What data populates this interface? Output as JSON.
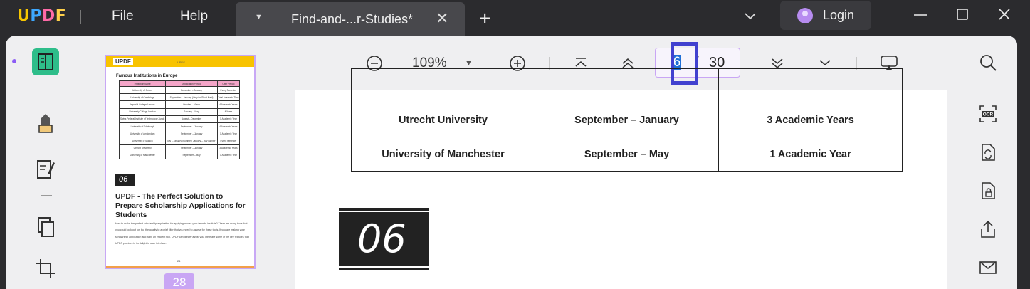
{
  "app": {
    "logo": {
      "u": "U",
      "p": "P",
      "d": "D",
      "f": "F"
    },
    "menu": {
      "file": "File",
      "help": "Help"
    },
    "tab": {
      "title": "Find-and-...r-Studies*"
    },
    "login": {
      "label": "Login"
    }
  },
  "toolbar": {
    "zoom": "109%",
    "page_current": "6",
    "page_separator": "/",
    "page_total": "30"
  },
  "thumbnail": {
    "page_label": "28",
    "logo": "UPDF",
    "header_mid": "UPDF",
    "title": "Famous Institutions in Europe",
    "table_header": [
      "Institution Name",
      "Application Period",
      "Offer Period"
    ],
    "table_rows": [
      [
        "University of Oxford",
        "December – January",
        "Every Semester"
      ],
      [
        "University of Cambridge",
        "September – January (Only for Short-lived)",
        "Total Academic Time"
      ],
      [
        "Imperial College London",
        "October – March",
        "4 Academic Years"
      ],
      [
        "University College London",
        "January – May",
        "4 Years"
      ],
      [
        "Swiss Federal Institute of Technology Zurich",
        "August – December",
        "1 Academic Year"
      ],
      [
        "University of Edinburgh",
        "September – January",
        "4 Academic Years"
      ],
      [
        "University of Amsterdam",
        "September – January",
        "1 Academic Year"
      ],
      [
        "University of Munich",
        "July – January (Summer) January – July (Winter)",
        "Every Semester"
      ],
      [
        "Utrecht University",
        "September – January",
        "3 Academic Years"
      ],
      [
        "University of Manchester",
        "September – May",
        "1 Academic Year"
      ]
    ],
    "chapter_num": "06",
    "heading": "UPDF - The Perfect Solution to Prepare Scholarship Applications for Students",
    "paragraph": "How to make the perfect scholarship application for applying across your favorite institute? There are many tools that you could look out for, but the quality to a chief filter that you need to assess for these tools. If you are making your scholarship application and want an efficient tool, UPDF can greatly assist you. Here are some of the key features that UPDF provides in its delightful user interface.",
    "page_number": "24"
  },
  "document": {
    "rows": [
      [
        "Utrecht University",
        "September – January",
        "3 Academic Years"
      ],
      [
        "University of Manchester",
        "September – May",
        "1 Academic Year"
      ]
    ],
    "chapter_num": "06"
  }
}
